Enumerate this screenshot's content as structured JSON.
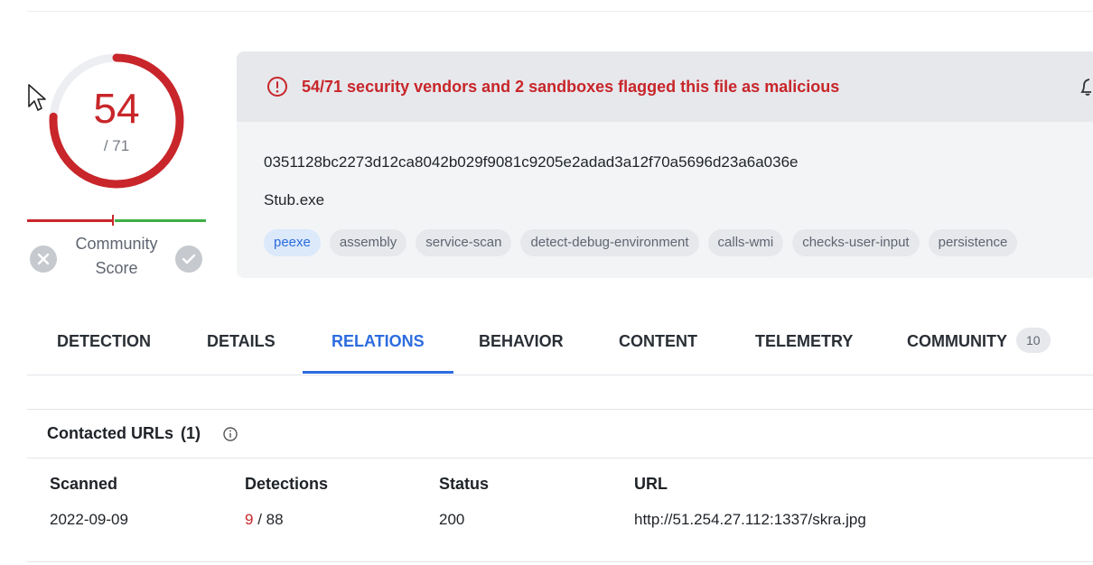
{
  "score": {
    "detected": "54",
    "total": "/ 71",
    "detected_value": 54,
    "total_value": 71
  },
  "community": {
    "label_line1": "Community",
    "label_line2": "Score"
  },
  "alert": {
    "text": "54/71 security vendors and 2 sandboxes flagged this file as malicious"
  },
  "file": {
    "hash": "0351128bc2273d12ca8042b029f9081c9205e2adad3a12f70a5696d23a6a036e",
    "name": "Stub.exe",
    "tags": [
      "peexe",
      "assembly",
      "service-scan",
      "detect-debug-environment",
      "calls-wmi",
      "checks-user-input",
      "persistence"
    ]
  },
  "tabs": [
    {
      "label": "DETECTION"
    },
    {
      "label": "DETAILS"
    },
    {
      "label": "RELATIONS",
      "active": true
    },
    {
      "label": "BEHAVIOR"
    },
    {
      "label": "CONTENT"
    },
    {
      "label": "TELEMETRY"
    },
    {
      "label": "COMMUNITY",
      "count": "10"
    }
  ],
  "contacted_urls": {
    "title": "Contacted URLs",
    "count": "(1)",
    "columns": [
      "Scanned",
      "Detections",
      "Status",
      "URL"
    ],
    "rows": [
      {
        "scanned": "2022-09-09",
        "detections_hit": "9",
        "detections_total": "/ 88",
        "status": "200",
        "url": "http://51.254.27.112:1337/skra.jpg"
      }
    ]
  },
  "colors": {
    "malicious": "#c8262a",
    "accent": "#2d6cdf",
    "harmless": "#3fae47"
  },
  "icons": {
    "alert": "alert-circle-icon",
    "bell": "bell-icon",
    "info": "info-icon",
    "vote_down": "x-circle-icon",
    "vote_up": "check-circle-icon",
    "cursor": "mouse-cursor-icon"
  }
}
